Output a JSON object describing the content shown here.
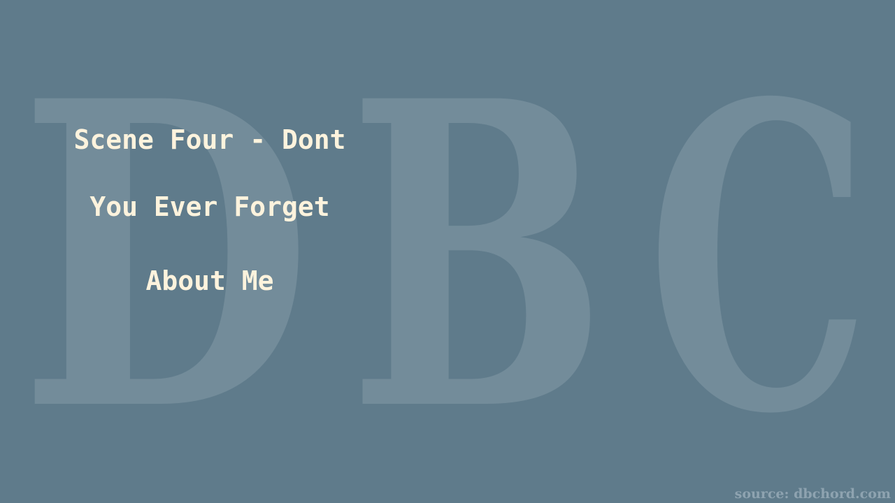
{
  "watermark": {
    "letter_1": "D",
    "letter_2": "B",
    "letter_3": "C",
    "color": "#738c9a"
  },
  "title": {
    "line_1": "Scene Four - Dont",
    "line_2": "You Ever Forget",
    "line_3": "About Me",
    "color": "#fdf3dd"
  },
  "source": {
    "text": "source: dbchord.com"
  },
  "background_color": "#5f7b8b"
}
